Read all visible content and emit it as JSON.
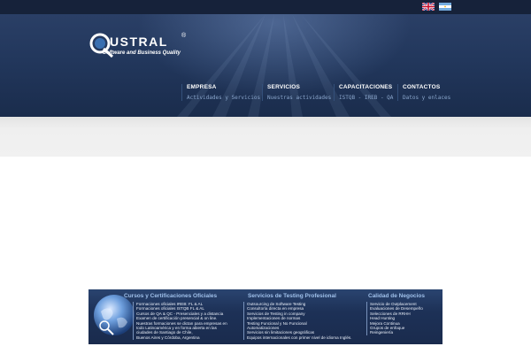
{
  "header": {
    "flags": [
      {
        "name": "english-flag"
      },
      {
        "name": "argentina-flag"
      }
    ],
    "logo": {
      "text": "USTRAL",
      "registered": "®",
      "tagline": "Software and Business Quality"
    },
    "nav": [
      {
        "title": "EMPRESA",
        "sub": "Actividades y Servicios"
      },
      {
        "title": "SERVICIOS",
        "sub": "Nuestras actividades"
      },
      {
        "title": "CAPACITACIONES",
        "sub": "ISTQB - IREB - QA"
      },
      {
        "title": "CONTACTOS",
        "sub": "Datos y enlaces"
      }
    ]
  },
  "footer": {
    "col1": {
      "title": "Cursos y Certificaciones Oficiales",
      "items": [
        "Formaciones oficiales IREB: FL & AL",
        "Formaciones oficiales ISTQB FL & AL",
        "Cursos de QA & QC - Presenciales y a distancia",
        "Examen de certificación presencial & on line.",
        "Nuestras  formaciones se dictan para empresas en",
        "todo Latinoamérica y en forma abierta en las",
        "ciudades de Santiago de Chile,",
        "Buenos Aires y Córdoba, Argentina"
      ]
    },
    "col2": {
      "title": "Servicios de Testing Profesional",
      "items": [
        "Outsourcing de Software Testing",
        "Consultoría directa en empresa",
        "Servicios de Testing in company",
        "Implementaciones de normas",
        "Testing Funcional y No Funcional",
        "Automatizaciones",
        "Servicios sin limitaciones geográficas",
        "Equipos internacionales con primer nivel de idioma Inglés."
      ]
    },
    "col3": {
      "title": "Calidad de Negocios",
      "items": [
        "Servicio de Outplacement",
        "Evaluaciones de Desempeño",
        "Selecciones de RRHH",
        "Head Hunting",
        "Mejora Continua",
        "Grupos de enfoque",
        "Reingeniería"
      ]
    }
  },
  "colors": {
    "header_dark": "#16223a",
    "hero_blue": "#22375c",
    "nav_sub": "#8aa6cc",
    "footer_title": "#9fc0ea"
  }
}
